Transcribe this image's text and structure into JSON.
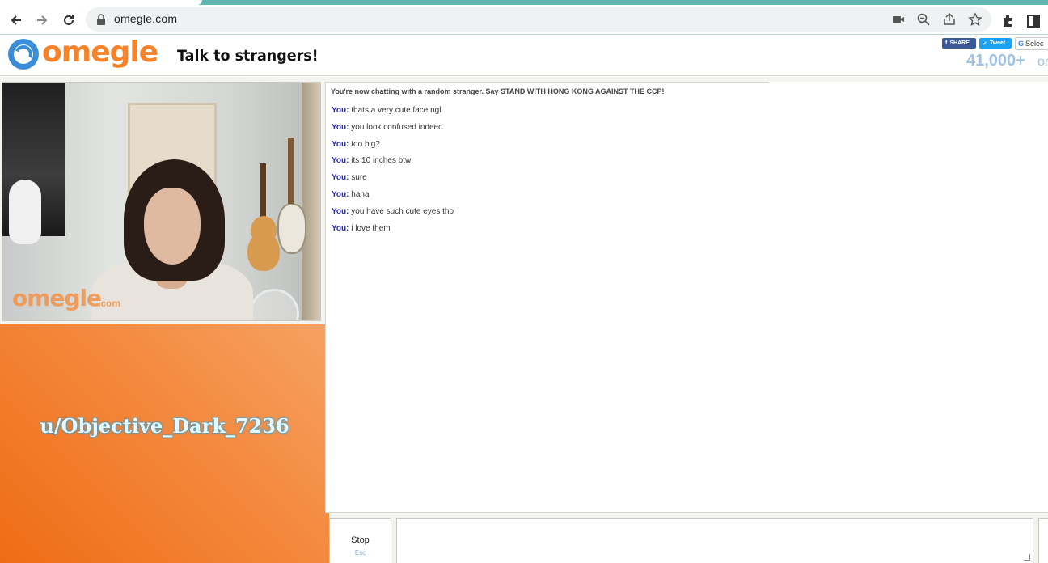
{
  "browser": {
    "url": "omegle.com"
  },
  "header": {
    "logo_text": "omegle",
    "tagline": "Talk to strangers!",
    "fb_share": "SHARE",
    "tw_share": "Tweet",
    "translate_select": "Selec",
    "online_count": "41,000+",
    "online_suffix": "or"
  },
  "video": {
    "watermark": "omegle",
    "watermark_suffix": ".com"
  },
  "self_video": {
    "overlay_text": "u/Objective_Dark_7236"
  },
  "chat": {
    "status": "You're now chatting with a random stranger. Say STAND WITH HONG KONG AGAINST THE CCP!",
    "messages": [
      {
        "who": "You:",
        "text": "thats a very cute face ngl"
      },
      {
        "who": "You:",
        "text": "you look confused indeed"
      },
      {
        "who": "You:",
        "text": "too big?"
      },
      {
        "who": "You:",
        "text": "its 10 inches btw"
      },
      {
        "who": "You:",
        "text": "sure"
      },
      {
        "who": "You:",
        "text": "haha"
      },
      {
        "who": "You:",
        "text": "you have such cute eyes tho"
      },
      {
        "who": "You:",
        "text": "i love them"
      }
    ]
  },
  "controls": {
    "stop_label": "Stop",
    "stop_key": "Esc",
    "message_value": ""
  },
  "colors": {
    "brand_orange": "#f6822a",
    "brand_blue": "#3a8ed8",
    "you_label": "#2c2cb0",
    "online_count": "#9fc3e2"
  }
}
